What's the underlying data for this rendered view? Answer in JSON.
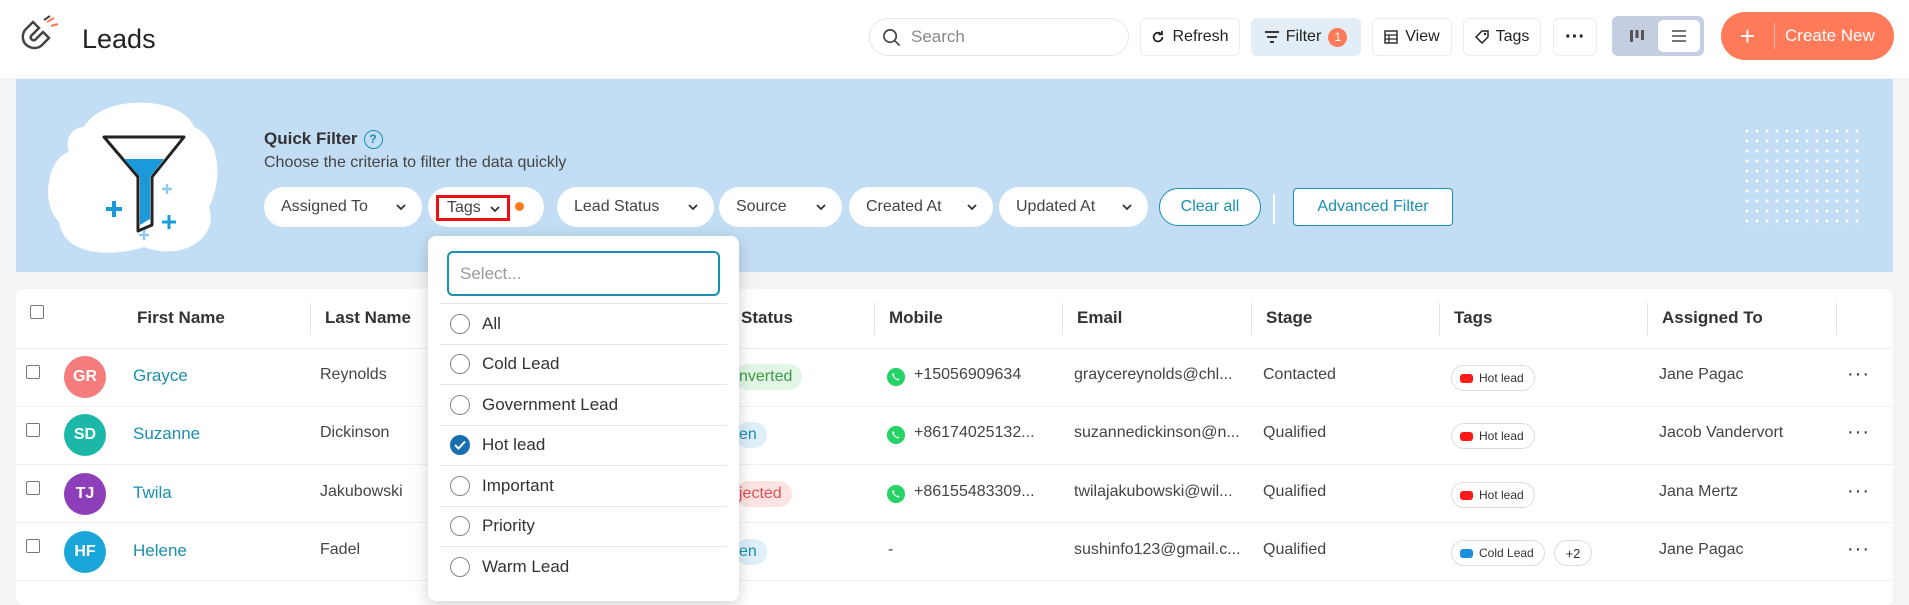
{
  "header": {
    "title": "Leads",
    "search_placeholder": "Search",
    "refresh_label": "Refresh",
    "filter_label": "Filter",
    "filter_count": "1",
    "view_label": "View",
    "tags_label": "Tags",
    "create_label": "Create New",
    "create_icon": "+"
  },
  "quick_filter": {
    "title": "Quick Filter",
    "help": "?",
    "subtitle": "Choose the criteria to filter the data quickly",
    "chips": {
      "assigned_to": "Assigned To",
      "tags": "Tags",
      "lead_status": "Lead Status",
      "source": "Source",
      "created_at": "Created At",
      "updated_at": "Updated At"
    },
    "clear_all": "Clear all",
    "advanced_filter": "Advanced Filter"
  },
  "tags_dropdown": {
    "placeholder": "Select...",
    "options": [
      {
        "label": "All",
        "checked": false
      },
      {
        "label": "Cold Lead",
        "checked": false
      },
      {
        "label": "Government Lead",
        "checked": false
      },
      {
        "label": "Hot lead",
        "checked": true
      },
      {
        "label": "Important",
        "checked": false
      },
      {
        "label": "Priority",
        "checked": false
      },
      {
        "label": "Warm Lead",
        "checked": false
      }
    ]
  },
  "table": {
    "columns": [
      "First Name",
      "Last Name",
      "Status",
      "Mobile",
      "Email",
      "Stage",
      "Tags",
      "Assigned To"
    ],
    "rows": [
      {
        "initials": "GR",
        "avatar_color": "#f47c7c",
        "first": "Grayce",
        "last": "Reynolds",
        "status": "nverted",
        "status_bg": "#e3f5e5",
        "status_color": "#3a9b47",
        "mobile": "+15056909634",
        "email": "graycereynolds@chl...",
        "stage": "Contacted",
        "tag": "Hot lead",
        "tag_color": "#ff1a1a",
        "tag_more": "",
        "assigned": "Jane Pagac"
      },
      {
        "initials": "SD",
        "avatar_color": "#1cb8a7",
        "first": "Suzanne",
        "last": "Dickinson",
        "status": "en",
        "status_bg": "#dff0fa",
        "status_color": "#1a8fb0",
        "mobile": "+86174025132...",
        "email": "suzannedickinson@n...",
        "stage": "Qualified",
        "tag": "Hot lead",
        "tag_color": "#ff1a1a",
        "tag_more": "",
        "assigned": "Jacob Vandervort"
      },
      {
        "initials": "TJ",
        "avatar_color": "#8c3fb8",
        "first": "Twila",
        "last": "Jakubowski",
        "status": "jected",
        "status_bg": "#fde4e4",
        "status_color": "#e05050",
        "mobile": "+86155483309...",
        "email": "twilajakubowski@wil...",
        "stage": "Qualified",
        "tag": "Hot lead",
        "tag_color": "#ff1a1a",
        "tag_more": "",
        "assigned": "Jana Mertz"
      },
      {
        "initials": "HF",
        "avatar_color": "#1aa6d8",
        "first": "Helene",
        "last": "Fadel",
        "status": "en",
        "status_bg": "#dff0fa",
        "status_color": "#1a8fb0",
        "mobile": "-",
        "email": "sushinfo123@gmail.c...",
        "stage": "Qualified",
        "tag": "Cold Lead",
        "tag_color": "#1a8fe0",
        "tag_more": "+2",
        "assigned": "Jane Pagac"
      }
    ],
    "row_menu": "···"
  },
  "icons": [
    "app-logo-icon",
    "search-icon",
    "refresh-icon",
    "filter-icon",
    "view-icon",
    "tag-icon",
    "more-icon",
    "kanban-icon",
    "list-icon",
    "chevron-down-icon",
    "whatsapp-icon",
    "funnel-illustration"
  ]
}
